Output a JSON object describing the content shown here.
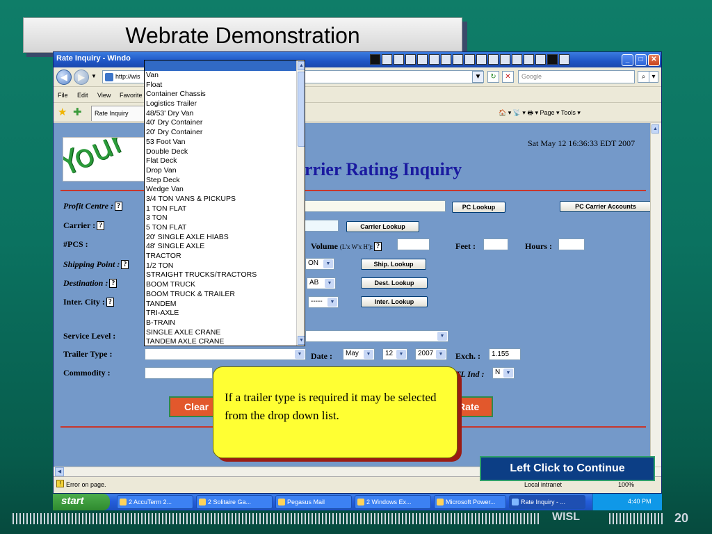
{
  "slide": {
    "title": "Webrate Demonstration",
    "callout": "If a trailer type is required it may be selected from the drop down list.",
    "continue_label": "Left Click to Continue",
    "footer_brand": "WISL",
    "page_number": "20"
  },
  "browser": {
    "window_title": "Rate Inquiry - Windo",
    "address_partial": "http://wis",
    "search_placeholder": "Google",
    "menus": [
      "File",
      "Edit",
      "View",
      "Favorite"
    ],
    "tab_label": "Rate Inquiry",
    "command_bar": "🏠 ▾  📡 ▾  🖶 ▾  Page ▾  Tools ▾",
    "status_left": "Error on page.",
    "status_zone": "Local intranet",
    "zoom": "100%"
  },
  "page": {
    "logo_text": "Your",
    "datetime": "Sat May 12 16:36:33 EDT 2007",
    "heading": "arrier Rating Inquiry",
    "labels": {
      "profit_centre": "Profit Centre :",
      "carrier": "Carrier :",
      "pcs": "#PCS :",
      "shipping_point": "Shipping Point :",
      "destination": "Destination :",
      "inter_city": "Inter. City :",
      "service_level": "Service Level :",
      "trailer_type": "Trailer Type :",
      "commodity": "Commodity :",
      "volume": "Volume",
      "volume_hint": "(L'x W'x H'):",
      "feet": "Feet :",
      "hours": "Hours :",
      "date": "Date :",
      "exch": "Exch. :",
      "tl_ind": "TL Ind :"
    },
    "buttons": {
      "pc_lookup": "PC Lookup",
      "pc_carrier_accounts": "PC Carrier Accounts",
      "carrier_lookup": "Carrier Lookup",
      "ship_lookup": "Ship. Lookup",
      "dest_lookup": "Dest. Lookup",
      "inter_lookup": "Inter. Lookup",
      "clear": "Clear",
      "rate": "Rate"
    },
    "selects": {
      "ship_province": "ON",
      "dest_province": "AB",
      "inter_province": "-----",
      "month": "May",
      "day": "12",
      "year": "2007",
      "tl_ind": "N"
    },
    "exch_value": "1.155"
  },
  "trailer_options": [
    "Van",
    "Float",
    "Container Chassis",
    "Logistics Trailer",
    "48/53' Dry Van",
    "40' Dry Container",
    "20' Dry Container",
    "53 Foot Van",
    "Double Deck",
    "Flat Deck",
    "Drop Van",
    "Step Deck",
    "Wedge Van",
    "3/4 TON VANS & PICKUPS",
    "1 TON FLAT",
    "3 TON",
    "5 TON FLAT",
    "20' SINGLE AXLE HIABS",
    "48' SINGLE AXLE",
    "TRACTOR",
    "1/2 TON",
    "STRAIGHT TRUCKS/TRACTORS",
    "BOOM TRUCK",
    "BOOM TRUCK & TRAILER",
    "TANDEM",
    "TRI-AXLE",
    "B-TRAIN",
    "SINGLE AXLE CRANE",
    "TANDEM AXLE CRANE"
  ],
  "taskbar": {
    "start_label": "start",
    "tasks": [
      "2 AccuTerm 2...",
      "2 Solitaire Ga...",
      "Pegasus Mail",
      "2 Windows Ex...",
      "Microsoft Power...",
      "Rate Inquiry - ..."
    ],
    "clock": "4:40 PM"
  },
  "colors": {
    "slide_background": "#0b7260",
    "content_background": "#7499c9",
    "callout_fill": "#ffff33",
    "heading_blue": "#1a1aa0",
    "selection_blue": "#316ac5"
  }
}
